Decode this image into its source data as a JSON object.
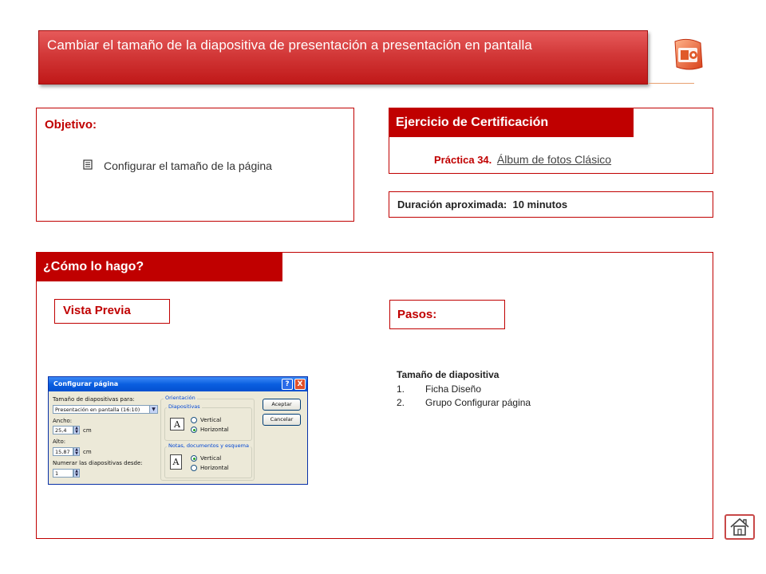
{
  "title": "Cambiar el tamaño de la diapositiva  de presentación a presentación  en pantalla",
  "objetivo": {
    "label": "Objetivo:",
    "bullet": "✓",
    "item": "Configurar el tamaño de la página"
  },
  "ejercicio": {
    "header": "Ejercicio de Certificación",
    "practice_prefix": "Práctica 34.",
    "practice_link": "Álbum de fotos Clásico"
  },
  "duracion": {
    "label": "Duración aproximada:",
    "value": "10 minutos"
  },
  "como": {
    "header": "¿Cómo lo hago?",
    "vista_label": "Vista Previa",
    "pasos_label": "Pasos:",
    "steps_title": "Tamaño de diapositiva",
    "steps": [
      {
        "num": "1.",
        "text": "Ficha Diseño"
      },
      {
        "num": "2.",
        "text": "Grupo Configurar página"
      }
    ]
  },
  "dialog": {
    "title": "Configurar página",
    "help": "?",
    "close": "X",
    "size_label": "Tamaño de diapositivas para:",
    "size_value": "Presentación en pantalla (16:10)",
    "width_label": "Ancho:",
    "width_value": "25,4",
    "width_unit": "cm",
    "height_label": "Alto:",
    "height_value": "15,87",
    "height_unit": "cm",
    "number_label": "Numerar las diapositivas desde:",
    "number_value": "1",
    "orientation_label": "Orientación",
    "slides_label": "Diapositivas",
    "slides_vertical": "Vertical",
    "slides_horizontal": "Horizontal",
    "notes_label": "Notas, documentos y esquema",
    "notes_vertical": "Vertical",
    "notes_horizontal": "Horizontal",
    "ok": "Aceptar",
    "cancel": "Cancelar",
    "page_glyph": "A"
  },
  "colors": {
    "accent": "#c00000",
    "banner": "#d23838"
  },
  "icons": {
    "app_logo": "powerpoint-logo-icon",
    "home": "home-icon"
  }
}
